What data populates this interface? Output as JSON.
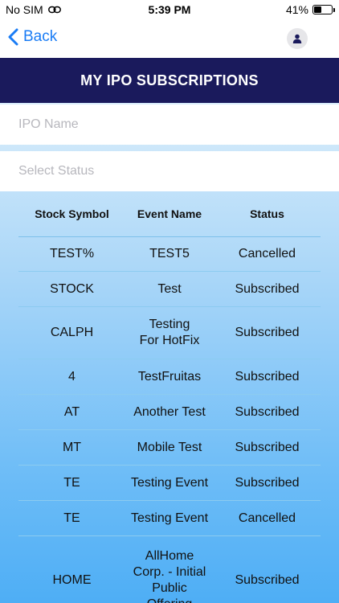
{
  "status_bar": {
    "carrier": "No SIM",
    "time": "5:39 PM",
    "battery": "41%",
    "battery_level": 0.41
  },
  "nav": {
    "back_label": "Back"
  },
  "page": {
    "title": "MY IPO SUBSCRIPTIONS"
  },
  "filters": {
    "ipo_name_placeholder": "IPO Name",
    "status_placeholder": "Select Status"
  },
  "table": {
    "headers": [
      "Stock Symbol",
      "Event Name",
      "Status"
    ],
    "rows": [
      {
        "symbol": "TEST%",
        "event": "TEST5",
        "status": "Cancelled"
      },
      {
        "symbol": "STOCK",
        "event": "Test",
        "status": "Subscribed"
      },
      {
        "symbol": "CALPH",
        "event": "Testing\nFor HotFix",
        "status": "Subscribed"
      },
      {
        "symbol": "4",
        "event": "TestFruitas",
        "status": "Subscribed"
      },
      {
        "symbol": "AT",
        "event": "Another Test",
        "status": "Subscribed"
      },
      {
        "symbol": "MT",
        "event": "Mobile Test",
        "status": "Subscribed"
      },
      {
        "symbol": "TE",
        "event": "Testing Event",
        "status": "Subscribed"
      },
      {
        "symbol": "TE",
        "event": "Testing Event",
        "status": "Cancelled"
      },
      {
        "symbol": "HOME",
        "event": "AllHome\nCorp. - Initial\nPublic\nOffering",
        "status": "Subscribed"
      }
    ]
  },
  "colors": {
    "accent": "#1a7cf5",
    "title_bar": "#1a1a5c"
  }
}
